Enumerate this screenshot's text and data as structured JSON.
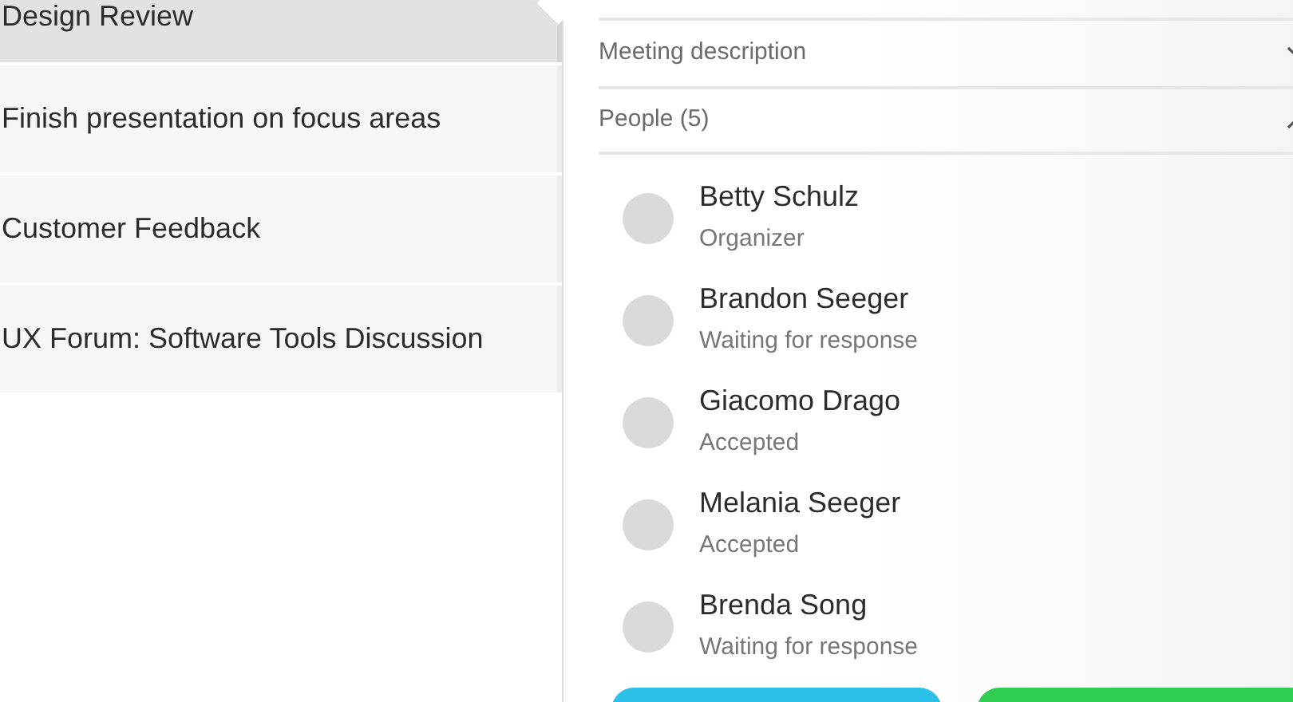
{
  "events": [
    {
      "title": "Design Review",
      "selected": true
    },
    {
      "title": "Finish presentation on focus areas",
      "selected": false
    },
    {
      "title": "Customer Feedback",
      "selected": false
    },
    {
      "title": "UX Forum: Software Tools Discussion",
      "selected": false
    }
  ],
  "details": {
    "sections": [
      {
        "label": "Meeting description",
        "expanded": false
      },
      {
        "label": "People (5)",
        "expanded": true
      }
    ],
    "people": [
      {
        "name": "Betty Schulz",
        "status": "Organizer"
      },
      {
        "name": "Brandon Seeger",
        "status": "Waiting for response"
      },
      {
        "name": "Giacomo Drago",
        "status": "Accepted"
      },
      {
        "name": "Melania Seeger",
        "status": "Accepted"
      },
      {
        "name": "Brenda Song",
        "status": "Waiting for response"
      }
    ],
    "actions": [
      {
        "kind": "primary"
      },
      {
        "kind": "success"
      }
    ]
  }
}
